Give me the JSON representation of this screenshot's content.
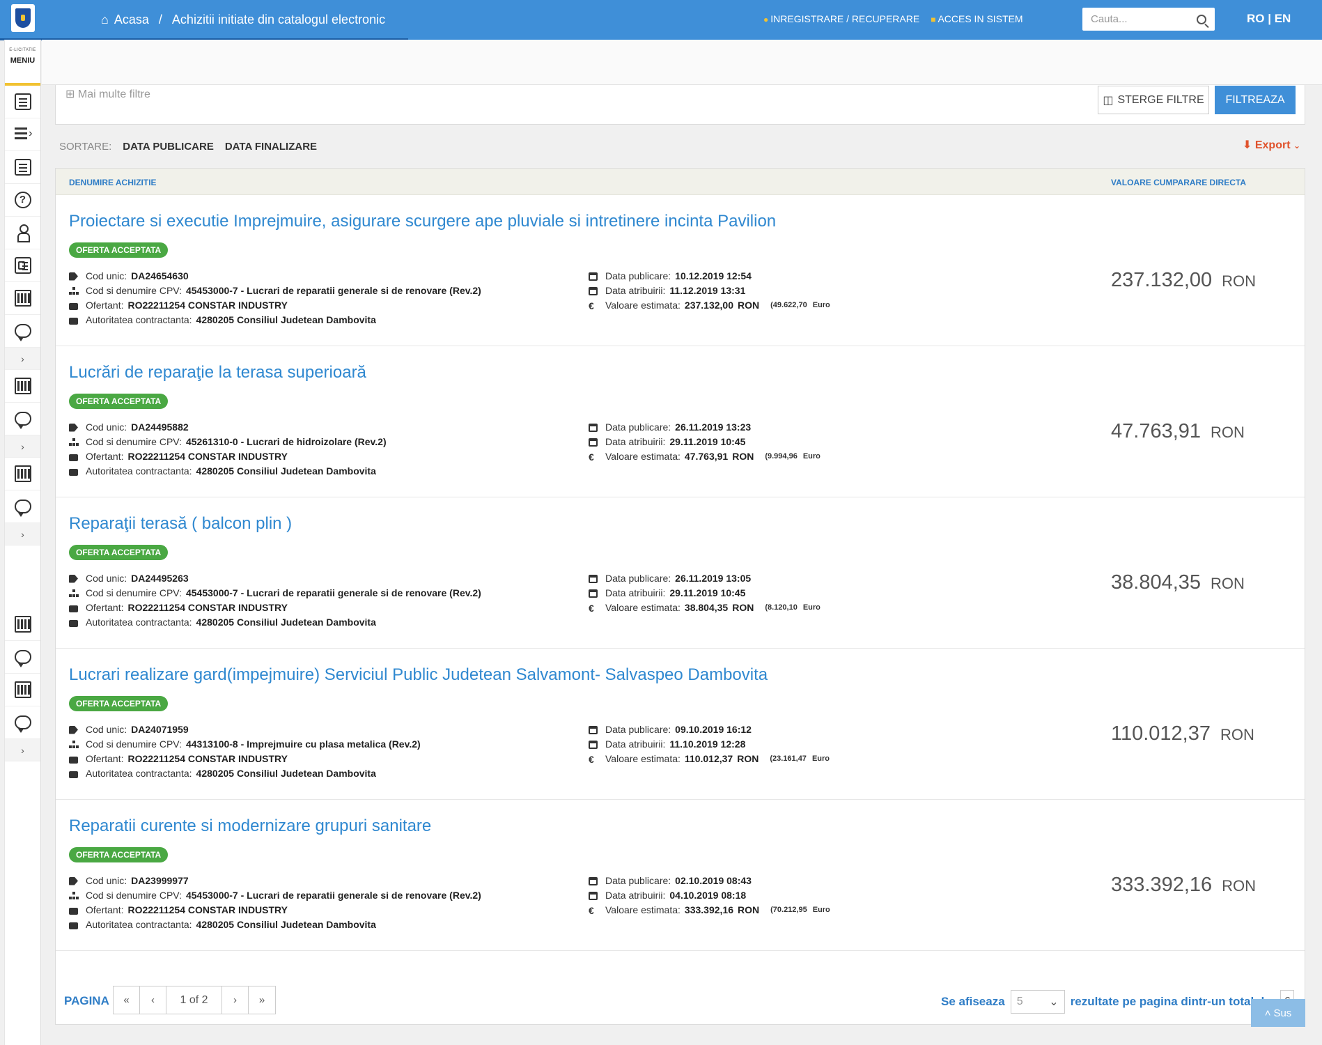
{
  "header": {
    "breadcrumb_home": "Acasa",
    "breadcrumb_sep": "/",
    "breadcrumb_current": "Achizitii initiate din catalogul electronic",
    "link_register": "INREGISTRARE / RECUPERARE",
    "link_login": "ACCES IN SISTEM",
    "search_placeholder": "Cauta...",
    "lang": "RO | EN"
  },
  "sidebar": {
    "brand_small": "E-LICITATIE",
    "menu_label": "MENIU",
    "chevron": "›"
  },
  "filters": {
    "more_filters": "Mai multe filtre",
    "clear_label": "STERGE FILTRE",
    "filter_label": "FILTREAZA"
  },
  "sort": {
    "label": "SORTARE:",
    "option_1": "DATA PUBLICARE",
    "option_2": "DATA FINALIZARE",
    "export_label": "Export"
  },
  "table": {
    "col_name": "DENUMIRE ACHIZITIE",
    "col_value": "VALOARE CUMPARARE DIRECTA",
    "lbl_cod": "Cod unic:",
    "lbl_cpv": "Cod si denumire CPV:",
    "lbl_ofertant": "Ofertant:",
    "lbl_autoritate": "Autoritatea contractanta:",
    "lbl_publicare": "Data publicare:",
    "lbl_atribuire": "Data atribuirii:",
    "lbl_valoare": "Valoare estimata:",
    "currency": "RON",
    "euro": "Euro",
    "rows": [
      {
        "title": "Proiectare si executie Imprejmuire, asigurare scurgere ape pluviale si intretinere incinta Pavilion",
        "status": "OFERTA ACCEPTATA",
        "cod": "DA24654630",
        "cpv": "45453000-7 - Lucrari de reparatii generale si de renovare (Rev.2)",
        "ofertant": "RO22211254 CONSTAR INDUSTRY",
        "autoritate": "4280205 Consiliul Judetean Dambovita",
        "publicare": "10.12.2019 12:54",
        "atribuire": "11.12.2019 13:31",
        "estimata": "237.132,00",
        "euro_val": "(49.622,70",
        "valoare": "237.132,00"
      },
      {
        "title": "Lucrări de reparaţie la terasa superioară",
        "status": "OFERTA ACCEPTATA",
        "cod": "DA24495882",
        "cpv": "45261310-0 - Lucrari de hidroizolare (Rev.2)",
        "ofertant": "RO22211254 CONSTAR INDUSTRY",
        "autoritate": "4280205 Consiliul Judetean Dambovita",
        "publicare": "26.11.2019 13:23",
        "atribuire": "29.11.2019 10:45",
        "estimata": "47.763,91",
        "euro_val": "(9.994,96",
        "valoare": "47.763,91"
      },
      {
        "title": "Reparaţii terasă ( balcon plin )",
        "status": "OFERTA ACCEPTATA",
        "cod": "DA24495263",
        "cpv": "45453000-7 - Lucrari de reparatii generale si de renovare (Rev.2)",
        "ofertant": "RO22211254 CONSTAR INDUSTRY",
        "autoritate": "4280205 Consiliul Judetean Dambovita",
        "publicare": "26.11.2019 13:05",
        "atribuire": "29.11.2019 10:45",
        "estimata": "38.804,35",
        "euro_val": "(8.120,10",
        "valoare": "38.804,35"
      },
      {
        "title": "Lucrari realizare gard(impejmuire) Serviciul Public Judetean Salvamont- Salvaspeo Dambovita",
        "status": "OFERTA ACCEPTATA",
        "cod": "DA24071959",
        "cpv": "44313100-8 - Imprejmuire cu plasa metalica (Rev.2)",
        "ofertant": "RO22211254 CONSTAR INDUSTRY",
        "autoritate": "4280205 Consiliul Judetean Dambovita",
        "publicare": "09.10.2019 16:12",
        "atribuire": "11.10.2019 12:28",
        "estimata": "110.012,37",
        "euro_val": "(23.161,47",
        "valoare": "110.012,37"
      },
      {
        "title": "Reparatii curente si modernizare grupuri sanitare",
        "status": "OFERTA ACCEPTATA",
        "cod": "DA23999977",
        "cpv": "45453000-7 - Lucrari de reparatii generale si de renovare (Rev.2)",
        "ofertant": "RO22211254 CONSTAR INDUSTRY",
        "autoritate": "4280205 Consiliul Judetean Dambovita",
        "publicare": "02.10.2019 08:43",
        "atribuire": "04.10.2019 08:18",
        "estimata": "333.392,16",
        "euro_val": "(70.212,95",
        "valoare": "333.392,16"
      }
    ]
  },
  "pager": {
    "label": "PAGINA",
    "first": "«",
    "prev": "‹",
    "current": "1 of 2",
    "next": "›",
    "last": "»",
    "show_label": "Se afiseaza",
    "per_page": "5",
    "suffix": "rezultate pe pagina dintr-un total de:",
    "total": "6",
    "up_label": "Sus"
  }
}
